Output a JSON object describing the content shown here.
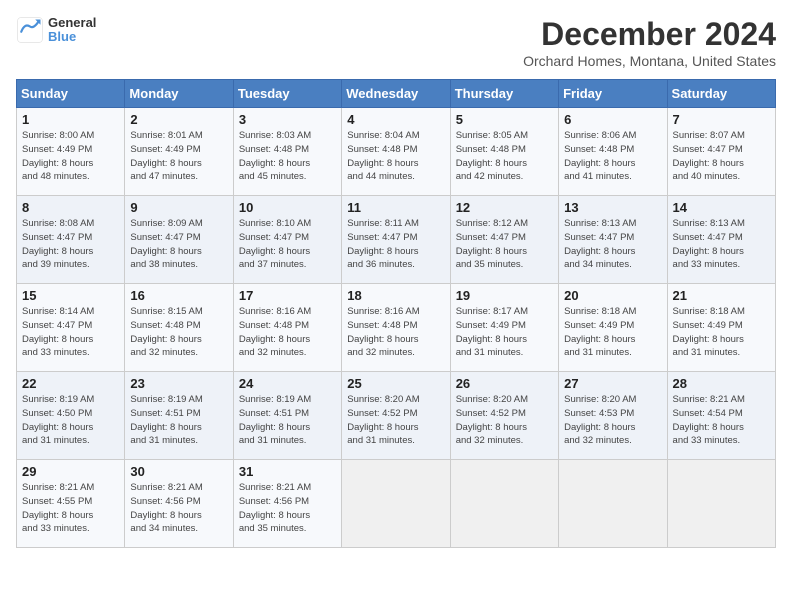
{
  "header": {
    "logo_line1": "General",
    "logo_line2": "Blue",
    "month": "December 2024",
    "location": "Orchard Homes, Montana, United States"
  },
  "days_of_week": [
    "Sunday",
    "Monday",
    "Tuesday",
    "Wednesday",
    "Thursday",
    "Friday",
    "Saturday"
  ],
  "weeks": [
    [
      {
        "day": "1",
        "info": "Sunrise: 8:00 AM\nSunset: 4:49 PM\nDaylight: 8 hours\nand 48 minutes."
      },
      {
        "day": "2",
        "info": "Sunrise: 8:01 AM\nSunset: 4:49 PM\nDaylight: 8 hours\nand 47 minutes."
      },
      {
        "day": "3",
        "info": "Sunrise: 8:03 AM\nSunset: 4:48 PM\nDaylight: 8 hours\nand 45 minutes."
      },
      {
        "day": "4",
        "info": "Sunrise: 8:04 AM\nSunset: 4:48 PM\nDaylight: 8 hours\nand 44 minutes."
      },
      {
        "day": "5",
        "info": "Sunrise: 8:05 AM\nSunset: 4:48 PM\nDaylight: 8 hours\nand 42 minutes."
      },
      {
        "day": "6",
        "info": "Sunrise: 8:06 AM\nSunset: 4:48 PM\nDaylight: 8 hours\nand 41 minutes."
      },
      {
        "day": "7",
        "info": "Sunrise: 8:07 AM\nSunset: 4:47 PM\nDaylight: 8 hours\nand 40 minutes."
      }
    ],
    [
      {
        "day": "8",
        "info": "Sunrise: 8:08 AM\nSunset: 4:47 PM\nDaylight: 8 hours\nand 39 minutes."
      },
      {
        "day": "9",
        "info": "Sunrise: 8:09 AM\nSunset: 4:47 PM\nDaylight: 8 hours\nand 38 minutes."
      },
      {
        "day": "10",
        "info": "Sunrise: 8:10 AM\nSunset: 4:47 PM\nDaylight: 8 hours\nand 37 minutes."
      },
      {
        "day": "11",
        "info": "Sunrise: 8:11 AM\nSunset: 4:47 PM\nDaylight: 8 hours\nand 36 minutes."
      },
      {
        "day": "12",
        "info": "Sunrise: 8:12 AM\nSunset: 4:47 PM\nDaylight: 8 hours\nand 35 minutes."
      },
      {
        "day": "13",
        "info": "Sunrise: 8:13 AM\nSunset: 4:47 PM\nDaylight: 8 hours\nand 34 minutes."
      },
      {
        "day": "14",
        "info": "Sunrise: 8:13 AM\nSunset: 4:47 PM\nDaylight: 8 hours\nand 33 minutes."
      }
    ],
    [
      {
        "day": "15",
        "info": "Sunrise: 8:14 AM\nSunset: 4:47 PM\nDaylight: 8 hours\nand 33 minutes."
      },
      {
        "day": "16",
        "info": "Sunrise: 8:15 AM\nSunset: 4:48 PM\nDaylight: 8 hours\nand 32 minutes."
      },
      {
        "day": "17",
        "info": "Sunrise: 8:16 AM\nSunset: 4:48 PM\nDaylight: 8 hours\nand 32 minutes."
      },
      {
        "day": "18",
        "info": "Sunrise: 8:16 AM\nSunset: 4:48 PM\nDaylight: 8 hours\nand 32 minutes."
      },
      {
        "day": "19",
        "info": "Sunrise: 8:17 AM\nSunset: 4:49 PM\nDaylight: 8 hours\nand 31 minutes."
      },
      {
        "day": "20",
        "info": "Sunrise: 8:18 AM\nSunset: 4:49 PM\nDaylight: 8 hours\nand 31 minutes."
      },
      {
        "day": "21",
        "info": "Sunrise: 8:18 AM\nSunset: 4:49 PM\nDaylight: 8 hours\nand 31 minutes."
      }
    ],
    [
      {
        "day": "22",
        "info": "Sunrise: 8:19 AM\nSunset: 4:50 PM\nDaylight: 8 hours\nand 31 minutes."
      },
      {
        "day": "23",
        "info": "Sunrise: 8:19 AM\nSunset: 4:51 PM\nDaylight: 8 hours\nand 31 minutes."
      },
      {
        "day": "24",
        "info": "Sunrise: 8:19 AM\nSunset: 4:51 PM\nDaylight: 8 hours\nand 31 minutes."
      },
      {
        "day": "25",
        "info": "Sunrise: 8:20 AM\nSunset: 4:52 PM\nDaylight: 8 hours\nand 31 minutes."
      },
      {
        "day": "26",
        "info": "Sunrise: 8:20 AM\nSunset: 4:52 PM\nDaylight: 8 hours\nand 32 minutes."
      },
      {
        "day": "27",
        "info": "Sunrise: 8:20 AM\nSunset: 4:53 PM\nDaylight: 8 hours\nand 32 minutes."
      },
      {
        "day": "28",
        "info": "Sunrise: 8:21 AM\nSunset: 4:54 PM\nDaylight: 8 hours\nand 33 minutes."
      }
    ],
    [
      {
        "day": "29",
        "info": "Sunrise: 8:21 AM\nSunset: 4:55 PM\nDaylight: 8 hours\nand 33 minutes."
      },
      {
        "day": "30",
        "info": "Sunrise: 8:21 AM\nSunset: 4:56 PM\nDaylight: 8 hours\nand 34 minutes."
      },
      {
        "day": "31",
        "info": "Sunrise: 8:21 AM\nSunset: 4:56 PM\nDaylight: 8 hours\nand 35 minutes."
      },
      null,
      null,
      null,
      null
    ]
  ]
}
